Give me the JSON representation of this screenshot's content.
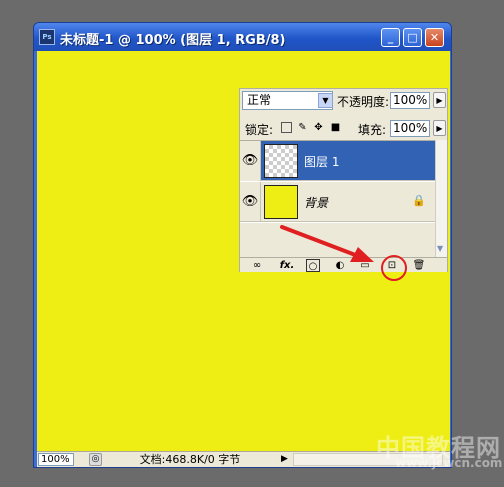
{
  "window": {
    "app_icon_text": "Ps",
    "title": "未标题-1 @ 100% (图层 1, RGB/8)",
    "buttons": {
      "minimize": "_",
      "maximize": "□",
      "close": "✕"
    }
  },
  "canvas": {
    "fill_color": "#eeee14"
  },
  "status_bar": {
    "zoom": "100%",
    "doc_info": "文档:468.8K/0 字节",
    "menu_arrow": "▶"
  },
  "layers_panel": {
    "blend_mode": "正常",
    "opacity_label": "不透明度:",
    "opacity_value": "100%",
    "lock_label": "锁定:",
    "fill_label": "填充:",
    "fill_value": "100%",
    "layers": [
      {
        "name": "图层 1",
        "selected": true,
        "thumbnail": "transparent-checker",
        "visible": true
      },
      {
        "name": "背景",
        "selected": false,
        "thumbnail": "#eeee14",
        "visible": true,
        "locked": true
      }
    ],
    "bottom_icons": [
      "link-layers-icon",
      "fx-icon",
      "layer-mask-icon",
      "adjustment-layer-icon",
      "new-group-icon",
      "new-layer-icon",
      "delete-layer-icon"
    ]
  },
  "annotation": {
    "arrow_color": "#e02020",
    "highlight": "new-layer-icon"
  },
  "watermark": {
    "line1": "中国教程网",
    "line2": "www.jcwcn.com"
  }
}
